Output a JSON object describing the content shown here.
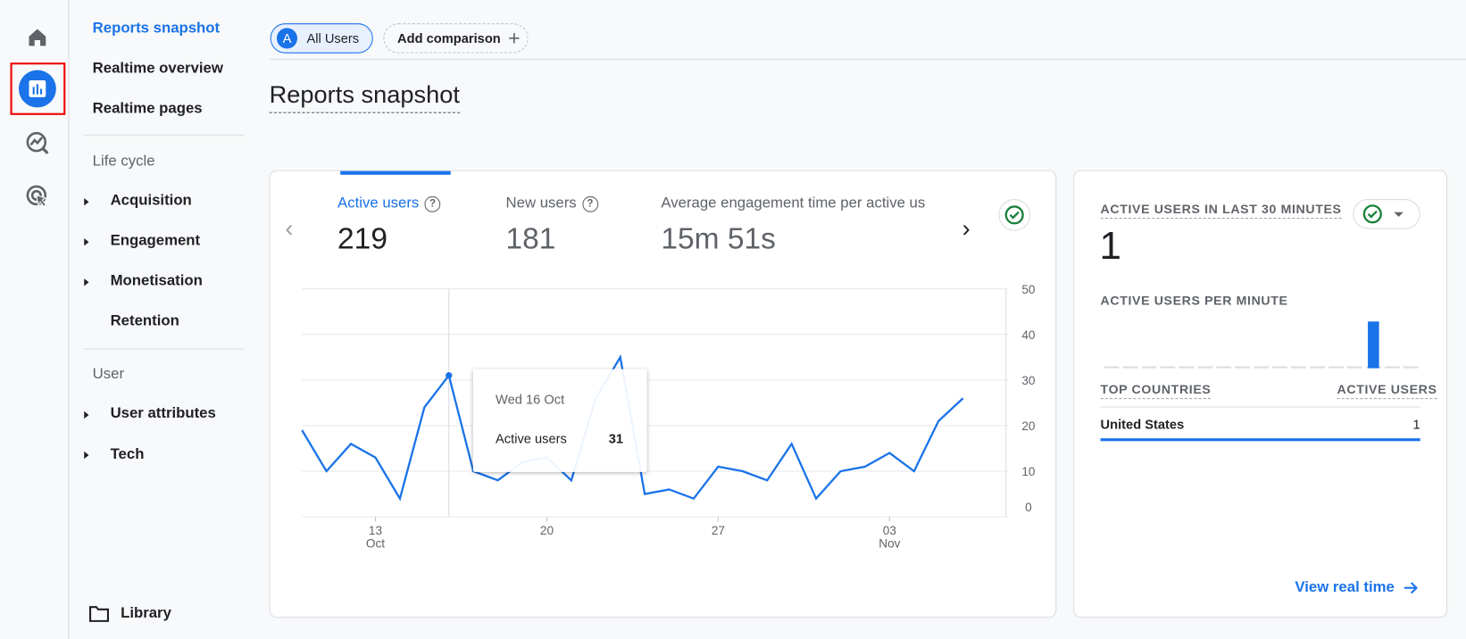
{
  "rail": {
    "items": [
      {
        "icon": "home-icon"
      },
      {
        "icon": "reports-icon",
        "selected": true
      },
      {
        "icon": "explore-icon"
      },
      {
        "icon": "advertising-icon"
      }
    ]
  },
  "nav": {
    "items": {
      "reports_snapshot": "Reports snapshot",
      "realtime_overview": "Realtime overview",
      "realtime_pages": "Realtime pages"
    },
    "lifecycle_heading": "Life cycle",
    "lifecycle": [
      "Acquisition",
      "Engagement",
      "Monetisation",
      "Retention"
    ],
    "user_heading": "User",
    "user": [
      "User attributes",
      "Tech"
    ],
    "library": "Library"
  },
  "header": {
    "segment_letter": "A",
    "segment_label": "All Users",
    "add_comparison": "Add comparison",
    "title": "Reports snapshot"
  },
  "metrics": [
    {
      "label": "Active users",
      "value": "219",
      "selected": true
    },
    {
      "label": "New users",
      "value": "181"
    },
    {
      "label": "Average engagement time per active us",
      "value": "15m 51s"
    }
  ],
  "tooltip": {
    "date": "Wed 16 Oct",
    "label": "Active users",
    "value": "31"
  },
  "chart_data": {
    "type": "line",
    "x": [
      "Oct 10",
      "Oct 11",
      "Oct 12",
      "Oct 13",
      "Oct 14",
      "Oct 15",
      "Oct 16",
      "Oct 17",
      "Oct 18",
      "Oct 19",
      "Oct 20",
      "Oct 21",
      "Oct 22",
      "Oct 23",
      "Oct 24",
      "Oct 25",
      "Oct 26",
      "Oct 27",
      "Oct 28",
      "Oct 29",
      "Oct 30",
      "Oct 31",
      "Nov 1",
      "Nov 2",
      "Nov 3",
      "Nov 4",
      "Nov 5",
      "Nov 6"
    ],
    "series": [
      {
        "values": [
          19,
          10,
          16,
          13,
          4,
          24,
          31,
          10,
          8,
          12,
          13,
          8,
          26,
          35,
          5,
          6,
          4,
          11,
          10,
          8,
          16,
          4,
          10,
          11,
          14,
          10,
          21,
          26
        ]
      }
    ],
    "ylim": [
      0,
      50
    ],
    "yticks": [
      "0",
      "10",
      "20",
      "30",
      "40",
      "50"
    ],
    "xticks": [
      {
        "day": "13",
        "month": "Oct",
        "index": 3
      },
      {
        "day": "20",
        "month": "",
        "index": 10
      },
      {
        "day": "27",
        "month": "",
        "index": 17
      },
      {
        "day": "03",
        "month": "Nov",
        "index": 24
      }
    ],
    "highlight_index": 6,
    "grid": true,
    "color": "#1a73e8"
  },
  "realtime": {
    "title": "ACTIVE USERS IN LAST 30 MINUTES",
    "value": "1",
    "per_minute_title": "ACTIVE USERS PER MINUTE",
    "per_minute": [
      0,
      0,
      0,
      0,
      0,
      0,
      0,
      0,
      0,
      0,
      0,
      0,
      0,
      0,
      1,
      0,
      0
    ],
    "countries_header": "TOP COUNTRIES",
    "users_header": "ACTIVE USERS",
    "rows": [
      {
        "country": "United States",
        "users": "1",
        "share": 1.0
      }
    ],
    "view_link": "View real time"
  },
  "colors": {
    "accent": "#1a73e8",
    "ok": "#188038",
    "text": "#202124",
    "muted": "#5f6368"
  }
}
